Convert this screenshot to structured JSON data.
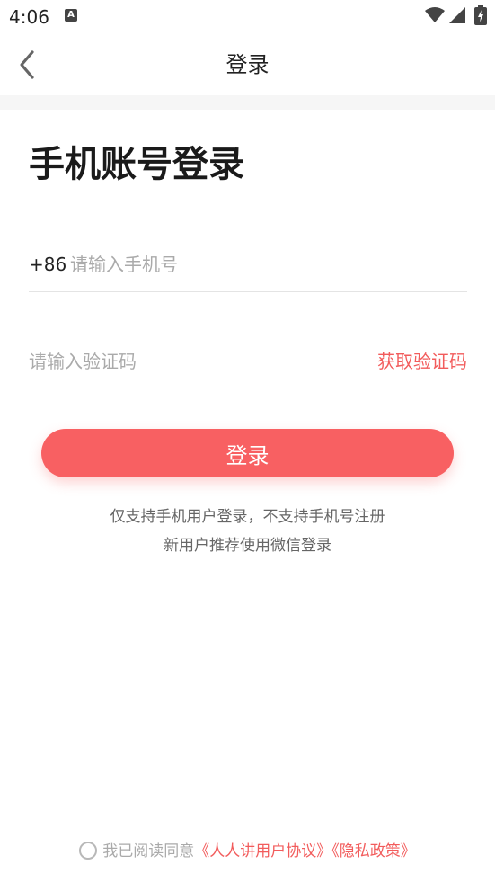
{
  "status_bar": {
    "time": "4:06",
    "notification_icon_letter": "A"
  },
  "header": {
    "title": "登录",
    "back_icon": "chevron-left-icon"
  },
  "main": {
    "heading": "手机账号登录",
    "phone": {
      "country_code": "+86",
      "placeholder": "请输入手机号",
      "value": ""
    },
    "code": {
      "placeholder": "请输入验证码",
      "value": "",
      "get_code_label": "获取验证码"
    },
    "login_label": "登录",
    "notice_line_1": "仅支持手机用户登录，不支持手机号注册",
    "notice_line_2": "新用户推荐使用微信登录"
  },
  "agreement": {
    "checked": false,
    "prefix": "我已阅读同意",
    "user_agreement": "《人人讲用户协议》",
    "privacy_policy": "《隐私政策》"
  },
  "colors": {
    "accent": "#f86062",
    "link": "#f25c5c",
    "placeholder": "#aaaaaa",
    "divider": "#e4e4e4"
  }
}
